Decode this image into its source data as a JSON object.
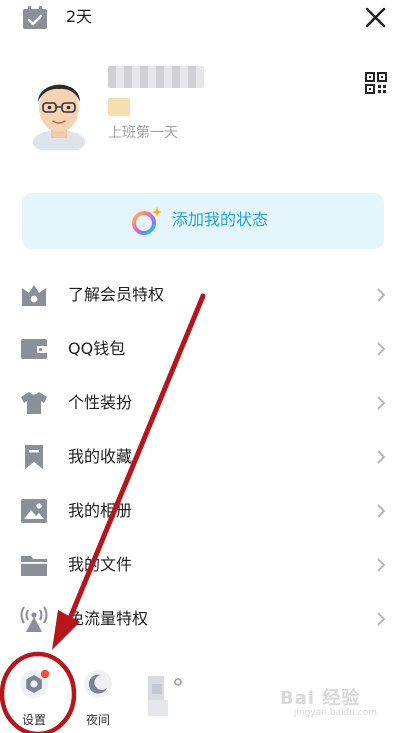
{
  "top_bar": {
    "streak_label": "2天",
    "calendar_icon": "calendar-check-icon",
    "close_icon": "close-icon"
  },
  "profile": {
    "signature": "上班第一天",
    "qr_icon": "qr-code-icon"
  },
  "status_card": {
    "label": "添加我的状态",
    "icon": "status-ring-sparkle-icon"
  },
  "menu": [
    {
      "label": "了解会员特权",
      "icon": "crown-shop-icon"
    },
    {
      "label": "QQ钱包",
      "icon": "wallet-icon"
    },
    {
      "label": "个性装扮",
      "icon": "tshirt-icon"
    },
    {
      "label": "我的收藏",
      "icon": "bookmark-icon"
    },
    {
      "label": "我的相册",
      "icon": "image-icon"
    },
    {
      "label": "我的文件",
      "icon": "folder-icon"
    },
    {
      "label": "免流量特权",
      "icon": "antenna-icon"
    }
  ],
  "bottom_bar": {
    "settings_label": "设置",
    "night_label": "夜间"
  },
  "watermark": {
    "text": "Bai 经验",
    "url": "jingyan.baidu.com"
  },
  "colors": {
    "accent": "#2aa4d6",
    "status_card_bg": "#e4f6fb",
    "icon_gray": "#8a8f99",
    "annotation_red": "#b5161b",
    "badge_red": "#f24f3f"
  }
}
